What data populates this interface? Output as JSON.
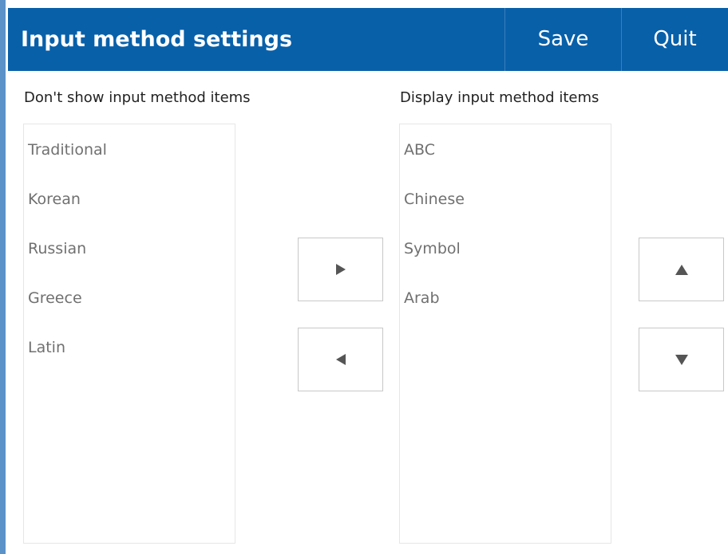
{
  "window": {
    "title": "Input method settings"
  },
  "toolbar": {
    "save_label": "Save",
    "quit_label": "Quit"
  },
  "hidden_list": {
    "label": "Don't show input method items",
    "items": [
      "Traditional",
      "Korean",
      "Russian",
      "Greece",
      "Latin"
    ]
  },
  "shown_list": {
    "label": "Display input method items",
    "items": [
      "ABC",
      "Chinese",
      "Symbol",
      "Arab"
    ]
  },
  "controls": {
    "move_right_icon": "triangle-right-icon",
    "move_left_icon": "triangle-left-icon",
    "move_up_icon": "triangle-up-icon",
    "move_down_icon": "triangle-down-icon"
  },
  "colors": {
    "header_bg": "#0860a9",
    "header_text": "#ffffff",
    "item_text": "#707070",
    "label_text": "#222222",
    "arrow": "#555555"
  }
}
